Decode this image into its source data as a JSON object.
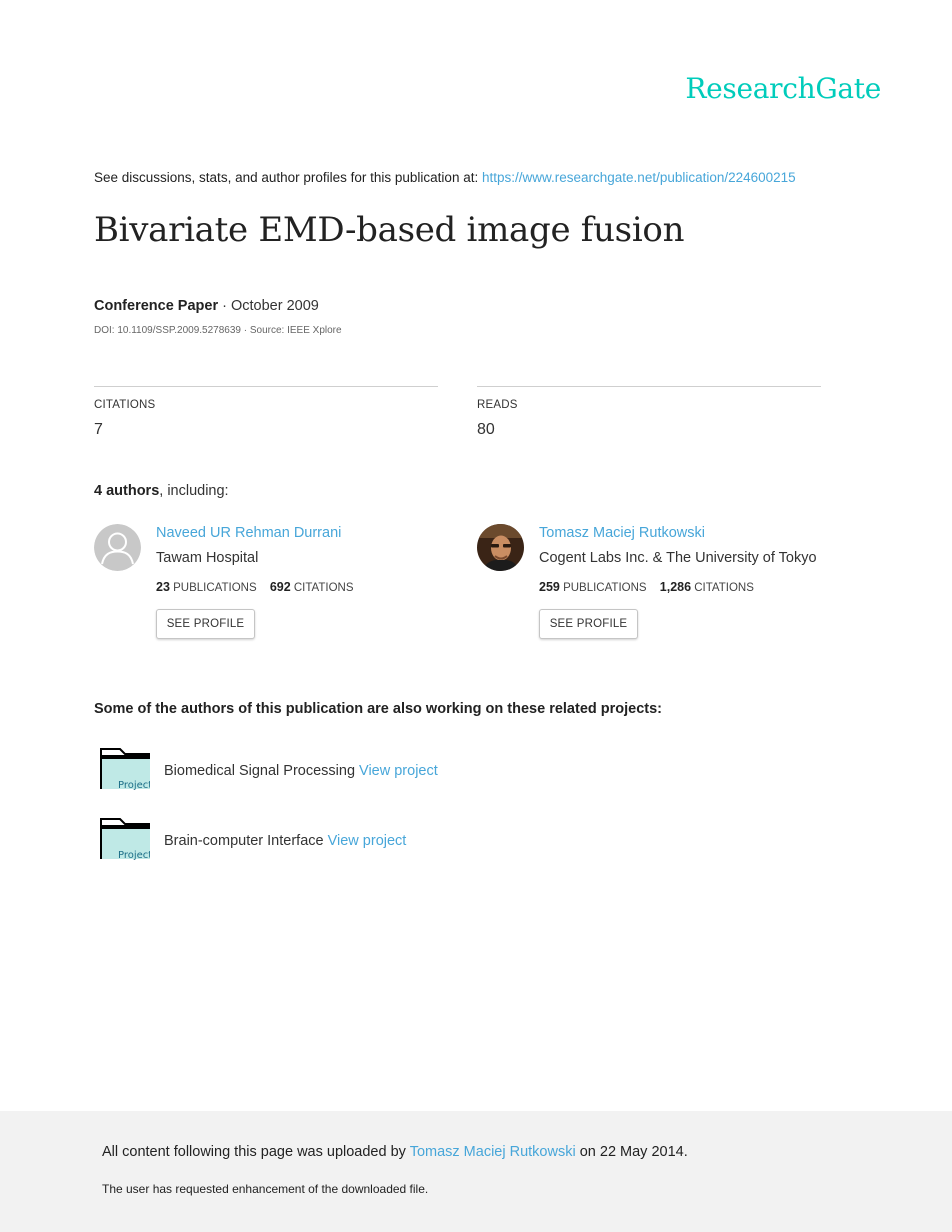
{
  "logo": "ResearchGate",
  "discussion": {
    "text": "See discussions, stats, and author profiles for this publication at:",
    "url": "https://www.researchgate.net/publication/224600215"
  },
  "title": "Bivariate EMD-based image fusion",
  "publication": {
    "type": "Conference Paper",
    "date": "· October 2009",
    "doi": "DOI: 10.1109/SSP.2009.5278639 · Source: IEEE Xplore"
  },
  "stats": {
    "citations_label": "CITATIONS",
    "citations_value": "7",
    "reads_label": "READS",
    "reads_value": "80"
  },
  "authors_heading": {
    "count": "4 authors",
    "suffix": ", including:"
  },
  "authors": [
    {
      "name": "Naveed UR Rehman Durrani",
      "institution": "Tawam Hospital",
      "publications": "23",
      "publications_label": "PUBLICATIONS",
      "citations": "692",
      "citations_label": "CITATIONS",
      "button": "SEE PROFILE"
    },
    {
      "name": "Tomasz Maciej Rutkowski",
      "institution": "Cogent Labs Inc. & The University of Tokyo",
      "publications": "259",
      "publications_label": "PUBLICATIONS",
      "citations": "1,286",
      "citations_label": "CITATIONS",
      "button": "SEE PROFILE"
    }
  ],
  "related_heading": "Some of the authors of this publication are also working on these related projects:",
  "projects": [
    {
      "icon_label": "Project",
      "name": "Biomedical Signal Processing",
      "link": "View project"
    },
    {
      "icon_label": "Project",
      "name": "Brain-computer Interface",
      "link": "View project"
    }
  ],
  "footer": {
    "uploaded_prefix": "All content following this page was uploaded by",
    "uploader": "Tomasz Maciej Rutkowski",
    "uploaded_suffix": "on 22 May 2014.",
    "request": "The user has requested enhancement of the downloaded file."
  },
  "colors": {
    "brand": "#00ccbb",
    "link": "#47a6d9",
    "footer_bg": "#f2f2f2",
    "folder_fill": "#bfe9e6"
  },
  "icons": [
    "default-avatar-icon",
    "author-photo",
    "project-folder-icon"
  ]
}
